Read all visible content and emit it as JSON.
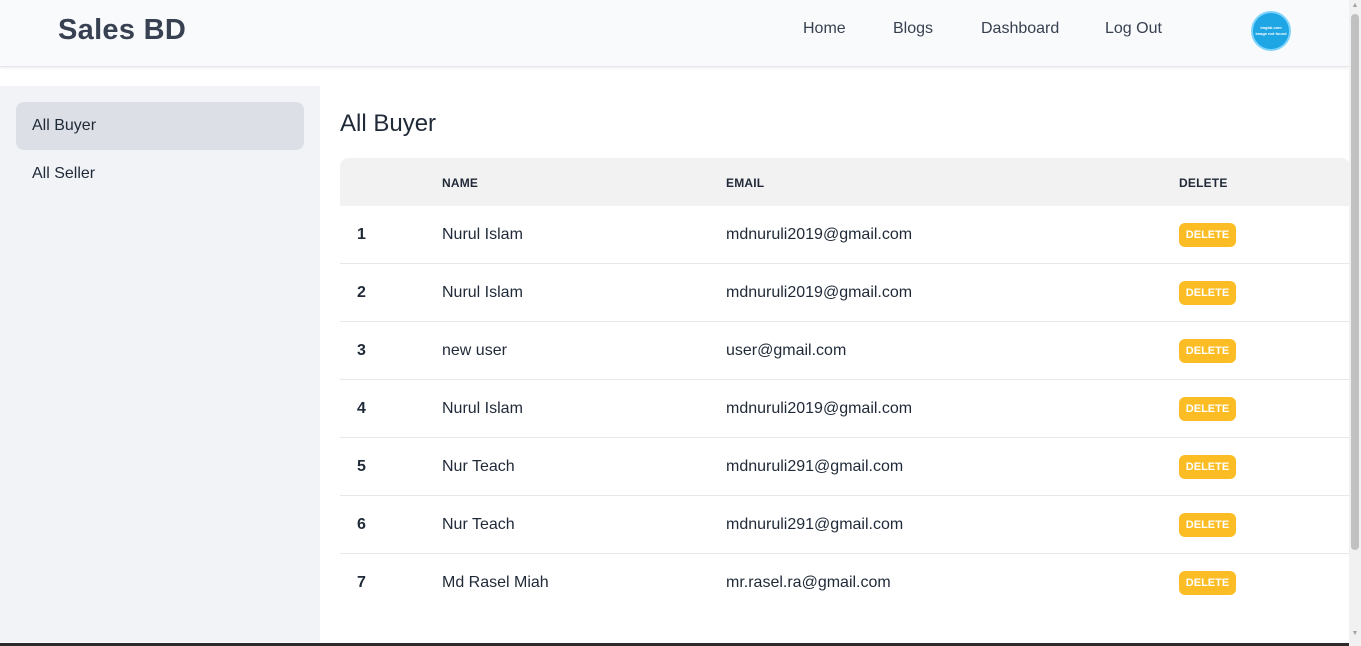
{
  "header": {
    "brand": "Sales BD",
    "nav": [
      "Home",
      "Blogs",
      "Dashboard",
      "Log Out"
    ],
    "avatar_text": [
      "imgbb.com",
      "image not found"
    ]
  },
  "sidebar": {
    "items": [
      {
        "label": "All Buyer",
        "active": true
      },
      {
        "label": "All Seller",
        "active": false
      }
    ]
  },
  "main": {
    "title": "All Buyer",
    "table": {
      "columns": [
        "",
        "NAME",
        "EMAIL",
        "DELETE"
      ],
      "delete_label": "DELETE",
      "rows": [
        {
          "num": "1",
          "name": "Nurul Islam",
          "email": "mdnuruli2019@gmail.com"
        },
        {
          "num": "2",
          "name": "Nurul Islam",
          "email": "mdnuruli2019@gmail.com"
        },
        {
          "num": "3",
          "name": "new user",
          "email": "user@gmail.com"
        },
        {
          "num": "4",
          "name": "Nurul Islam",
          "email": "mdnuruli2019@gmail.com"
        },
        {
          "num": "5",
          "name": "Nur Teach",
          "email": "mdnuruli291@gmail.com"
        },
        {
          "num": "6",
          "name": "Nur Teach",
          "email": "mdnuruli291@gmail.com"
        },
        {
          "num": "7",
          "name": "Md Rasel Miah",
          "email": "mr.rasel.ra@gmail.com"
        }
      ]
    }
  },
  "colors": {
    "accent_button": "#fbbd23",
    "sidebar_bg": "#f1f3f7",
    "sidebar_active": "#dcdfe5",
    "avatar_bg": "#1ea5e4"
  },
  "icons": {
    "scroll_up": "scroll-up-arrow-icon",
    "scroll_down": "scroll-down-arrow-icon"
  }
}
